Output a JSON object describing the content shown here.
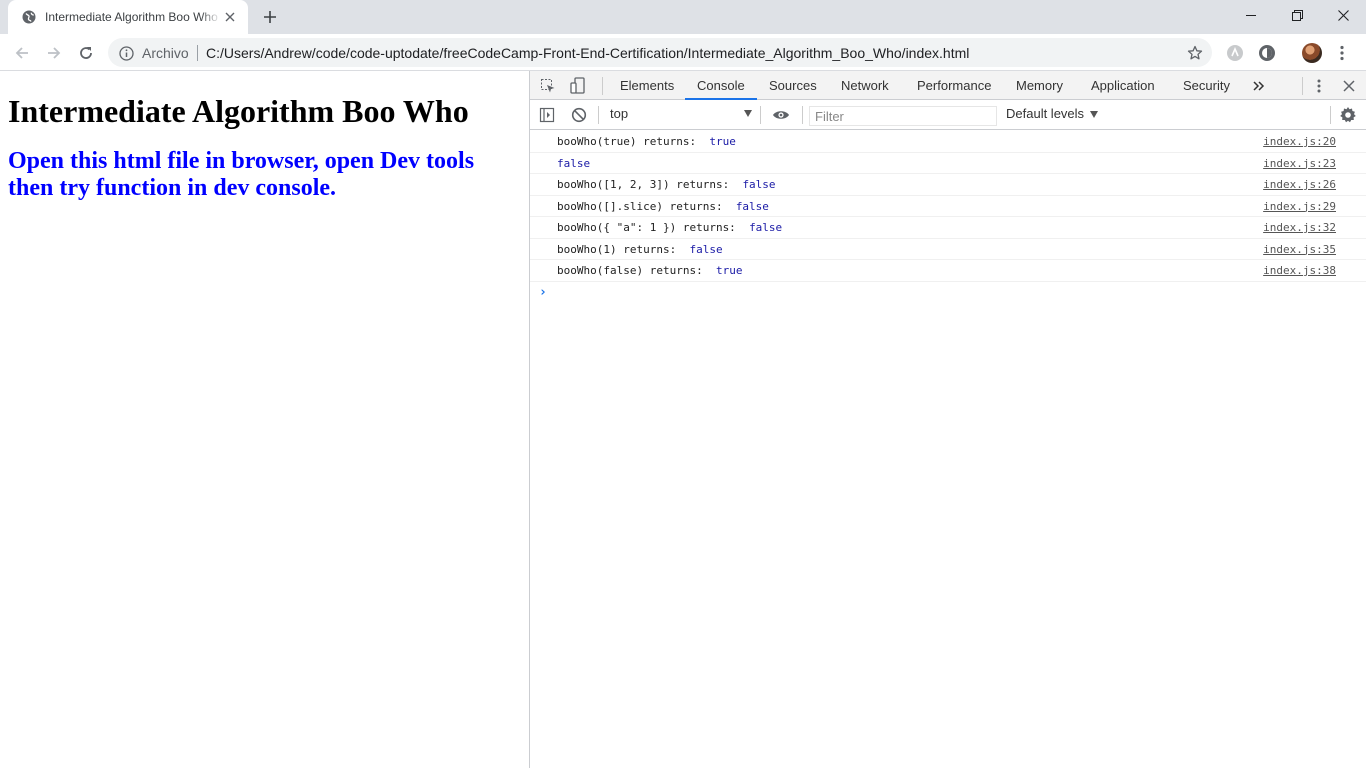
{
  "browser": {
    "tab": {
      "title": "Intermediate Algorithm Boo Who"
    },
    "omnibox": {
      "security_label": "Archivo",
      "url": "C:/Users/Andrew/code/code-uptodate/freeCodeCamp-Front-End-Certification/Intermediate_Algorithm_Boo_Who/index.html"
    }
  },
  "page": {
    "heading": "Intermediate Algorithm Boo Who",
    "subheading": "Open this html file in browser, open Dev tools then try function in dev console."
  },
  "devtools": {
    "tabs": [
      "Elements",
      "Console",
      "Sources",
      "Network",
      "Performance",
      "Memory",
      "Application",
      "Security"
    ],
    "active_tab": "Console",
    "console_toolbar": {
      "context": "top",
      "filter_placeholder": "Filter",
      "levels": "Default levels"
    },
    "messages": [
      {
        "text": "booWho(true) returns:  ",
        "value": "true",
        "source": "index.js:20"
      },
      {
        "text": "",
        "value": "false",
        "source": "index.js:23"
      },
      {
        "text": "booWho([1, 2, 3]) returns:  ",
        "value": "false",
        "source": "index.js:26"
      },
      {
        "text": "booWho([].slice) returns:  ",
        "value": "false",
        "source": "index.js:29"
      },
      {
        "text": "booWho({ \"a\": 1 }) returns:  ",
        "value": "false",
        "source": "index.js:32"
      },
      {
        "text": "booWho(1) returns:  ",
        "value": "false",
        "source": "index.js:35"
      },
      {
        "text": "booWho(false) returns:  ",
        "value": "true",
        "source": "index.js:38"
      }
    ]
  },
  "colors": {
    "accent": "#1a73e8",
    "console_value": "#1a1aa6",
    "page_subheading": "#0000ff"
  }
}
